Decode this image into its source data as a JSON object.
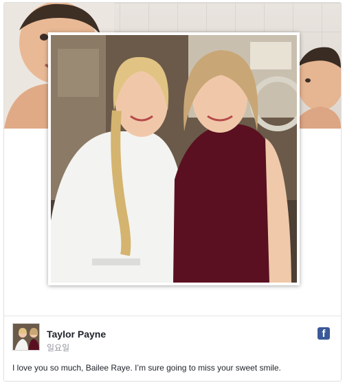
{
  "post": {
    "author": "Taylor Payne",
    "date": "일요일",
    "text": "I love you so much, Bailee Raye. I’m sure going to miss your sweet smile."
  },
  "icons": {
    "platform": "facebook-icon"
  },
  "colors": {
    "facebook_blue": "#3b5998",
    "author_text": "#1d2129",
    "meta_text": "#90949c",
    "dress": "#5a1020",
    "robe": "#f3f3f1"
  }
}
